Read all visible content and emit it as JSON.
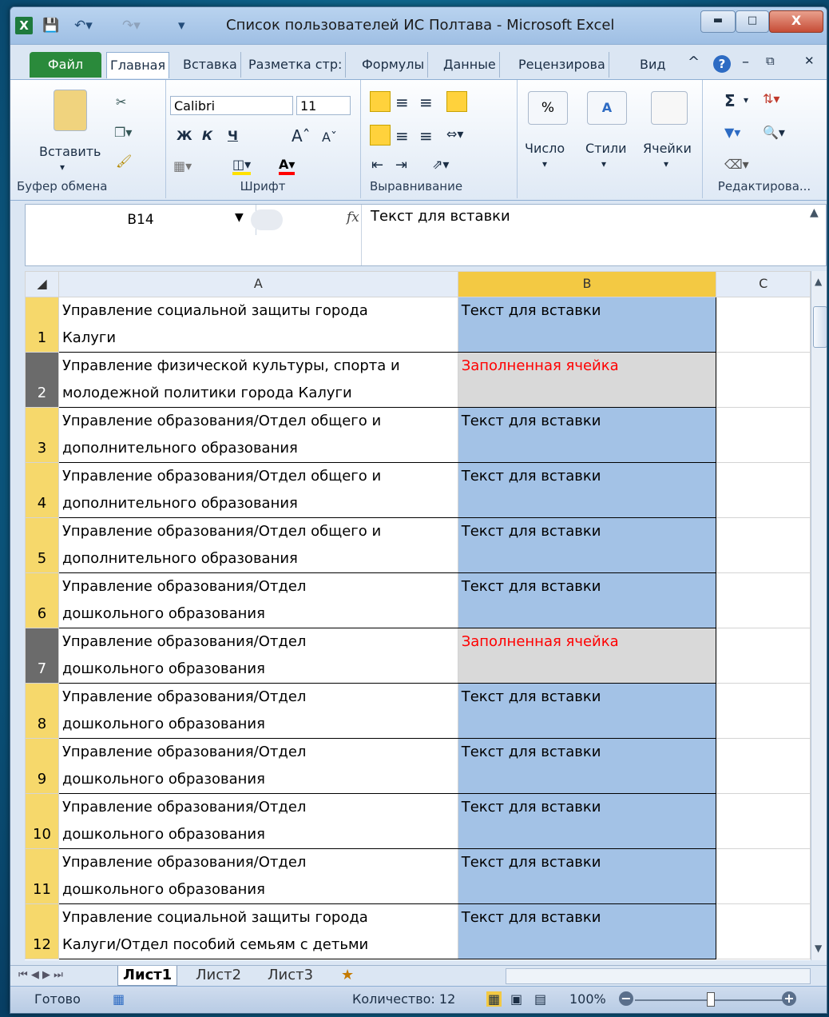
{
  "window": {
    "title": "Список пользователей ИС Полтава  -  Microsoft Excel"
  },
  "tabs": [
    "Файл",
    "Главная",
    "Вставка",
    "Разметка стр:",
    "Формулы",
    "Данные",
    "Рецензирова",
    "Вид"
  ],
  "ribbon": {
    "clipboard": {
      "paste": "Вставить",
      "label": "Буфер обмена"
    },
    "font": {
      "name": "Calibri",
      "size": "11",
      "bold": "Ж",
      "italic": "К",
      "underline": "Ч",
      "label": "Шрифт"
    },
    "alignment": {
      "label": "Выравнивание"
    },
    "number": {
      "button": "Число",
      "symbol": "%"
    },
    "styles": {
      "button": "Стили"
    },
    "cells": {
      "button": "Ячейки"
    },
    "editing": {
      "label": "Редактирова...",
      "sum": "Σ"
    }
  },
  "formula_bar": {
    "name_box": "B14",
    "fx": "fx",
    "formula": "Текст для вставки"
  },
  "columns": [
    "A",
    "B",
    "C"
  ],
  "rows": [
    {
      "num": "1",
      "a1": "Управление социальной защиты города",
      "a2": "Калуги",
      "b": "Текст для вставки",
      "type": "blue"
    },
    {
      "num": "2",
      "a1": "Управление физической культуры, спорта и",
      "a2": "молодежной политики города Калуги",
      "b": "Заполненная ячейка",
      "type": "gray"
    },
    {
      "num": "3",
      "a1": "Управление образования/Отдел общего и",
      "a2": "дополнительного образования",
      "b": "Текст для вставки",
      "type": "blue"
    },
    {
      "num": "4",
      "a1": "Управление образования/Отдел общего и",
      "a2": "дополнительного образования",
      "b": "Текст для вставки",
      "type": "blue"
    },
    {
      "num": "5",
      "a1": "Управление образования/Отдел общего и",
      "a2": "дополнительного образования",
      "b": "Текст для вставки",
      "type": "blue"
    },
    {
      "num": "6",
      "a1": "Управление образования/Отдел",
      "a2": "дошкольного образования",
      "b": "Текст для вставки",
      "type": "blue"
    },
    {
      "num": "7",
      "a1": "Управление образования/Отдел",
      "a2": "дошкольного образования",
      "b": "Заполненная ячейка",
      "type": "gray"
    },
    {
      "num": "8",
      "a1": "Управление образования/Отдел",
      "a2": "дошкольного образования",
      "b": "Текст для вставки",
      "type": "blue"
    },
    {
      "num": "9",
      "a1": "Управление образования/Отдел",
      "a2": "дошкольного образования",
      "b": "Текст для вставки",
      "type": "blue"
    },
    {
      "num": "10",
      "a1": "Управление образования/Отдел",
      "a2": "дошкольного образования",
      "b": "Текст для вставки",
      "type": "blue"
    },
    {
      "num": "11",
      "a1": "Управление образования/Отдел",
      "a2": "дошкольного образования",
      "b": "Текст для вставки",
      "type": "blue"
    },
    {
      "num": "12",
      "a1": "Управление социальной защиты города",
      "a2": "Калуги/Отдел пособий семьям с детьми",
      "b": "Текст для вставки",
      "type": "blue"
    }
  ],
  "sheets": [
    "Лист1",
    "Лист2",
    "Лист3"
  ],
  "status": {
    "ready": "Готово",
    "count": "Количество: 12",
    "zoom": "100%"
  }
}
